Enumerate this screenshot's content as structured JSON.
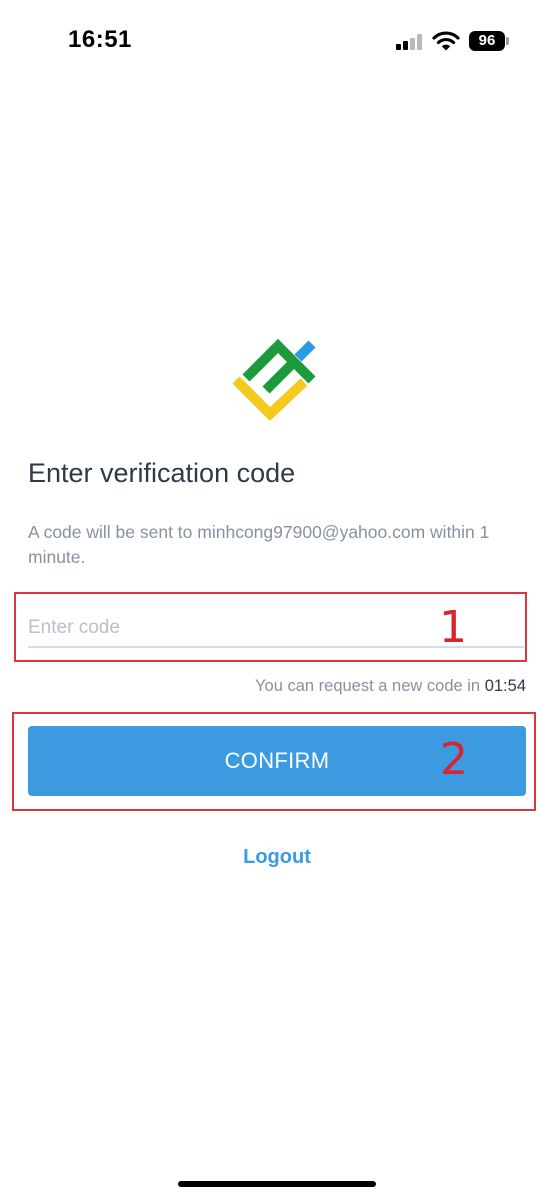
{
  "status_bar": {
    "time": "16:51",
    "battery": "96",
    "signal_bars": 2,
    "icons": [
      "signal-icon",
      "wifi-icon",
      "battery-icon"
    ]
  },
  "brand": {
    "logo": "brand-logo",
    "colors": {
      "green": "#1c9a3c",
      "yellow": "#f7c91c",
      "blue": "#2a9be3"
    }
  },
  "screen": {
    "title": "Enter verification code",
    "instruction": "A code will be sent to minhcong97900@yahoo.com within 1 minute."
  },
  "code_field": {
    "value": "",
    "placeholder": "Enter code"
  },
  "resend": {
    "text": "You can request a new code in",
    "timer": "01:54"
  },
  "confirm": {
    "label": "CONFIRM"
  },
  "logout": {
    "label": "Logout"
  },
  "annotations": {
    "marker_1": "1",
    "marker_2": "2",
    "color": "#d9232e"
  },
  "theme": {
    "accent": "#3b9ae0",
    "title_color": "#2e3a4a",
    "muted_text": "#8792a0"
  }
}
